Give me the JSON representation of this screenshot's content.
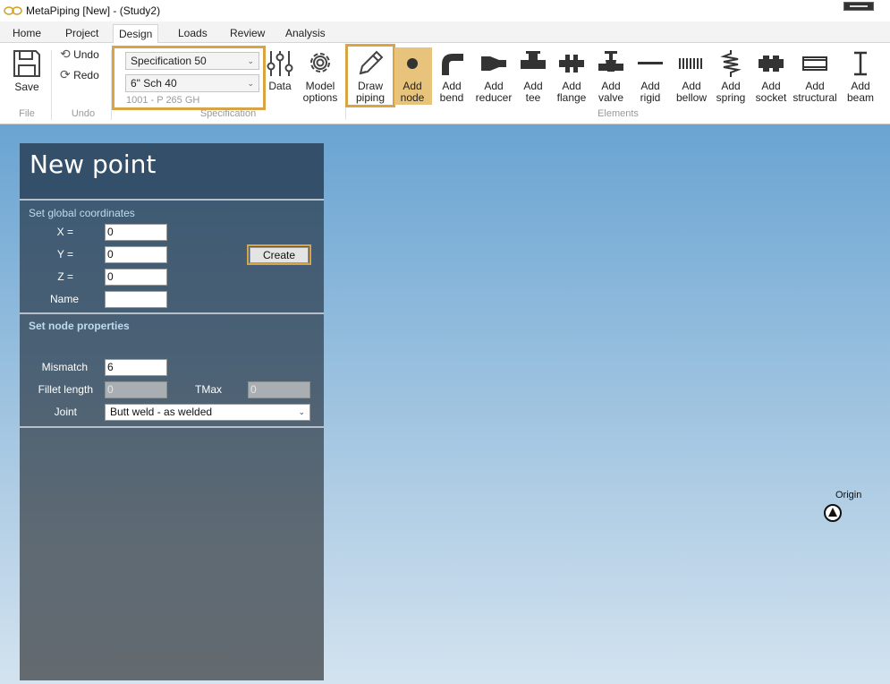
{
  "window": {
    "title": "MetaPiping [New] - (Study2)"
  },
  "tabs": [
    {
      "label": "Home"
    },
    {
      "label": "Project"
    },
    {
      "label": "Design",
      "active": true
    },
    {
      "label": "Loads"
    },
    {
      "label": "Review"
    },
    {
      "label": "Analysis"
    }
  ],
  "ribbon": {
    "file": {
      "save": "Save",
      "group": "File"
    },
    "undo": {
      "undo": "Undo",
      "redo": "Redo",
      "group": "Undo"
    },
    "specification": {
      "spec_value": "Specification 50",
      "size_value": "6\" Sch 40",
      "material": "1001 - P 265 GH",
      "group": "Specification",
      "data": "Data",
      "model_options": [
        "Model",
        "options"
      ]
    },
    "elements": {
      "group": "Elements",
      "draw_piping": [
        "Draw",
        "piping"
      ],
      "items": [
        {
          "l1": "Add",
          "l2": "node",
          "icon": "node-icon"
        },
        {
          "l1": "Add",
          "l2": "bend",
          "icon": "bend-icon"
        },
        {
          "l1": "Add",
          "l2": "reducer",
          "icon": "reducer-icon"
        },
        {
          "l1": "Add",
          "l2": "tee",
          "icon": "tee-icon"
        },
        {
          "l1": "Add",
          "l2": "flange",
          "icon": "flange-icon"
        },
        {
          "l1": "Add",
          "l2": "valve",
          "icon": "valve-icon"
        },
        {
          "l1": "Add",
          "l2": "rigid",
          "icon": "rigid-icon"
        },
        {
          "l1": "Add",
          "l2": "bellow",
          "icon": "bellow-icon"
        },
        {
          "l1": "Add",
          "l2": "spring",
          "icon": "spring-icon"
        },
        {
          "l1": "Add",
          "l2": "socket",
          "icon": "socket-icon"
        },
        {
          "l1": "Add",
          "l2": "structural",
          "icon": "structural-icon"
        },
        {
          "l1": "Add",
          "l2": "beam",
          "icon": "beam-icon"
        }
      ]
    }
  },
  "panel": {
    "title": "New point",
    "global": {
      "header": "Set global coordinates",
      "x_label": "X =",
      "x_value": "0",
      "y_label": "Y =",
      "y_value": "0",
      "z_label": "Z =",
      "z_value": "0",
      "name_label": "Name",
      "name_value": "",
      "create": "Create"
    },
    "node": {
      "header": "Set node properties",
      "mismatch_label": "Mismatch",
      "mismatch_value": "6",
      "fillet_label": "Fillet length",
      "fillet_value": "0",
      "tmax_label": "TMax",
      "tmax_value": "0",
      "joint_label": "Joint",
      "joint_value": "Butt weld - as welded"
    }
  },
  "viewport": {
    "origin_label": "Origin"
  },
  "colors": {
    "highlight": "#d9a443",
    "active_button": "#e8c37b"
  }
}
